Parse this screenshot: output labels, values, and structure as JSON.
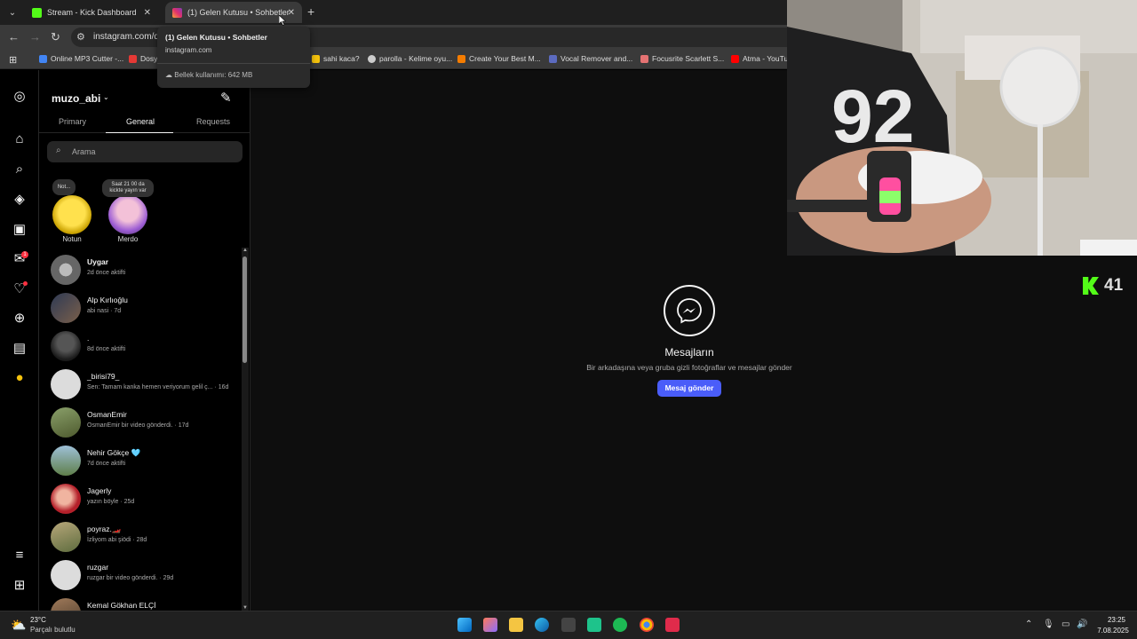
{
  "browser": {
    "tabs": [
      {
        "title": "Stream - Kick Dashboard"
      },
      {
        "title": "(1) Gelen Kutusu • Sohbetler"
      }
    ],
    "address": "instagram.com/di",
    "bookmarks": [
      "Online MP3 Cutter -...",
      "Dosy",
      "sahi kaca?",
      "parolla - Kelime oyu...",
      "Create Your Best M...",
      "Vocal Remover and...",
      "Focusrite Scarlett S...",
      "Atma - YouTu"
    ],
    "tooltip": {
      "title": "(1) Gelen Kutusu • Sohbetler",
      "url": "instagram.com",
      "memory": "Bellek kullanımı: 642 MB"
    }
  },
  "inbox": {
    "username": "muzo_abi",
    "tabs": [
      "Primary",
      "General",
      "Requests"
    ],
    "active_tab": "General",
    "search_placeholder": "Arama",
    "notes": [
      {
        "bubble": "Not...",
        "name": "Notun"
      },
      {
        "bubble": "Saat 21 00 da kickte yayın var",
        "name": "Merdo"
      }
    ],
    "conversations": [
      {
        "name": "Uygar",
        "sub": "2d önce aktifti",
        "bold": true
      },
      {
        "name": "Alp Kırlıoğlu",
        "sub": "abi nasi · 7d"
      },
      {
        "name": ".",
        "sub": "8d önce aktifti"
      },
      {
        "name": "_birisi79_",
        "sub": "Sen: Tamam kanka hemen veriyorum gelil ç... · 16d"
      },
      {
        "name": "OsmanEmir",
        "sub": "OsmanEmir bir video gönderdi. · 17d"
      },
      {
        "name": "Nehir Gökçe 🩵",
        "sub": "7d önce aktifti"
      },
      {
        "name": "Jagerly",
        "sub": "yazın böyle · 25d"
      },
      {
        "name": "poyraz.🏎️",
        "sub": "İzliyom abi şiödi · 28d"
      },
      {
        "name": "ruzgar",
        "sub": "ruzgar bir video gönderdi. · 29d"
      },
      {
        "name": "Kemal Gökhan ELÇİ",
        "sub": ""
      }
    ]
  },
  "main": {
    "title": "Mesajların",
    "subtitle": "Bir arkadaşına veya gruba gizli fotoğraflar ve mesajlar gönder",
    "button": "Mesaj gönder"
  },
  "webcam": {
    "jersey_number": "92"
  },
  "kick_viewers": "41",
  "taskbar": {
    "temperature": "23°C",
    "weather": "Parçalı bulutlu",
    "time": "23:25",
    "date": "7.08.2025"
  },
  "colors": {
    "accent": "#4a5df9",
    "kick_green": "#53fc18",
    "badge_red": "#ff3040"
  }
}
